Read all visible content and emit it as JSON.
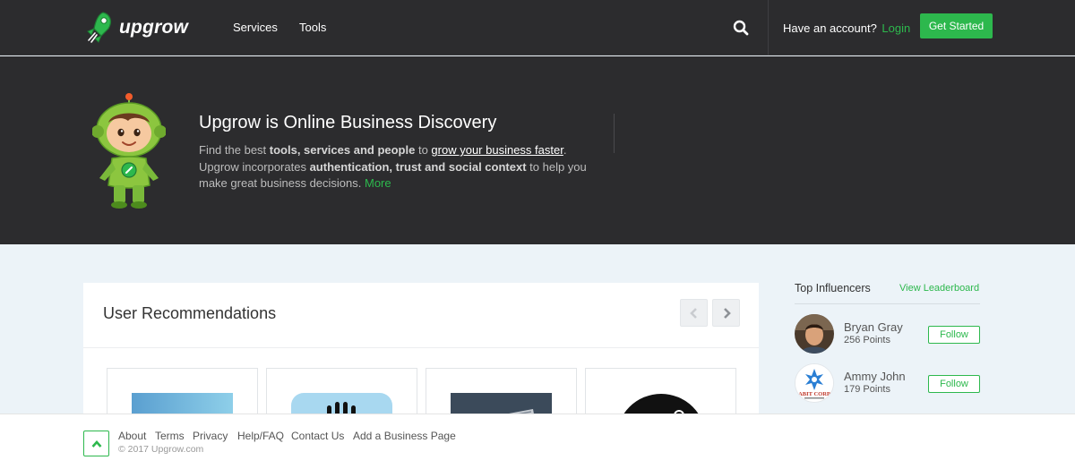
{
  "nav": {
    "brand": "upgrow",
    "links": [
      "Services",
      "Tools"
    ],
    "search_icon": "search-icon",
    "account_prompt": "Have an account?",
    "login_label": "Login",
    "cta_label": "Get Started"
  },
  "hero": {
    "title": "Upgrow is Online Business Discovery",
    "text_1": "Find the best ",
    "text_bold_1": "tools, services and people",
    "text_2": " to ",
    "text_link": "grow your business faster",
    "text_3": ".",
    "text_4": "Upgrow incorporates ",
    "text_bold_2": "authentication, trust and social context",
    "text_5": " to help you make great business decisions. ",
    "more_label": "More"
  },
  "recommendations": {
    "title": "User Recommendations",
    "prev_icon": "chevron-left-icon",
    "next_icon": "chevron-right-icon"
  },
  "influencers": {
    "title": "Top Influencers",
    "leaderboard_label": "View Leaderboard",
    "people": [
      {
        "name": "Bryan Gray",
        "points": "256 Points",
        "follow_label": "Follow"
      },
      {
        "name": "Ammy John",
        "points": "179 Points",
        "follow_label": "Follow",
        "logo_text": "ABIT CORP"
      }
    ]
  },
  "footer": {
    "links": [
      "About",
      "Terms",
      "Privacy",
      "Help/FAQ",
      "Contact Us",
      "Add a Business Page"
    ],
    "copyright": "© 2017 Upgrow.com"
  },
  "colors": {
    "brand_green": "#2db84d",
    "dark_bg": "#2c2c2e",
    "page_bg": "#ecf3f8"
  }
}
